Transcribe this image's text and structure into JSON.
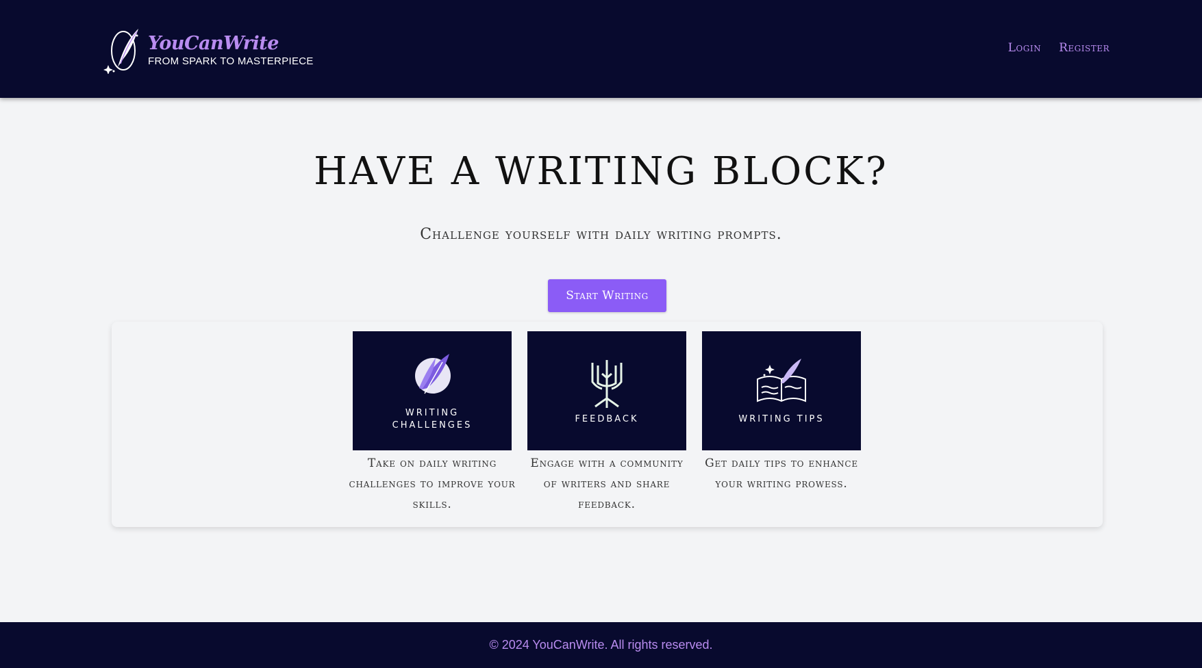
{
  "header": {
    "brand_name": "YouCanWrite",
    "tagline": "FROM SPARK TO MASTERPIECE",
    "nav": {
      "login": "Login",
      "register": "Register"
    }
  },
  "hero": {
    "title": "HAVE A WRITING BLOCK?",
    "subtitle": "Challenge yourself with daily writing prompts.",
    "cta_label": "Start Writing"
  },
  "features": [
    {
      "image_label_lines": [
        "WRITING",
        "CHALLENGES"
      ],
      "icon": "quill-moon-icon",
      "description": "Take on daily writing challenges to improve your skills."
    },
    {
      "image_label_lines": [
        "FEEDBACK"
      ],
      "icon": "tree-book-icon",
      "description": "Engage with a community of writers and share feedback."
    },
    {
      "image_label_lines": [
        "WRITING TIPS"
      ],
      "icon": "open-book-quill-icon",
      "description": "Get daily tips to enhance your writing prowess."
    }
  ],
  "footer": {
    "copyright": "© 2024 YouCanWrite. All rights reserved."
  },
  "colors": {
    "header_bg": "#080a2e",
    "accent": "#8b5cf6",
    "brand_purple": "#b98cf0",
    "page_bg": "#f3f4f6"
  }
}
